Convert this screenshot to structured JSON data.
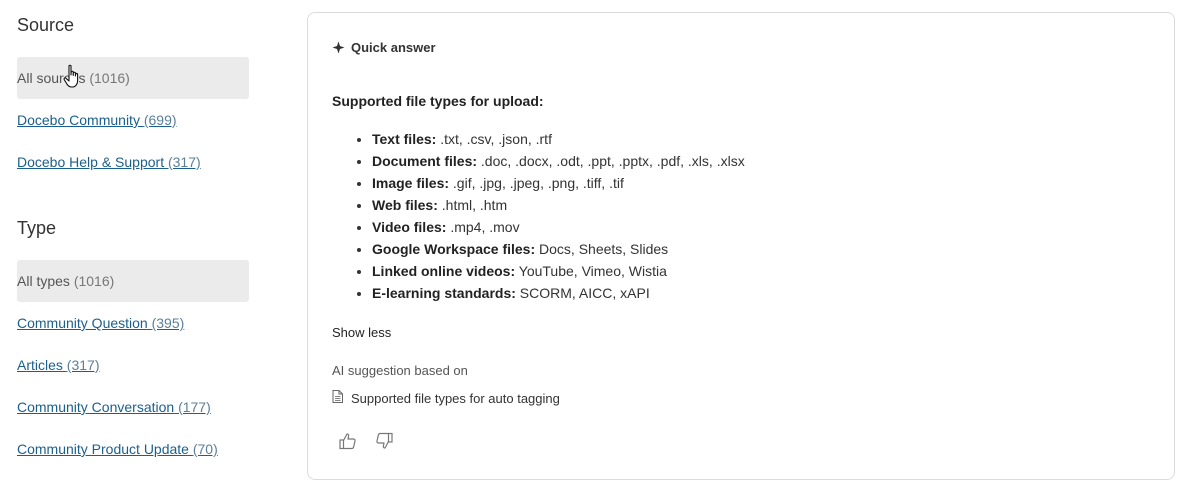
{
  "sidebar": {
    "source": {
      "title": "Source",
      "items": [
        {
          "label": "All sources",
          "count": "(1016)",
          "selected": true
        },
        {
          "label": "Docebo Community",
          "count": "(699)",
          "selected": false
        },
        {
          "label": "Docebo Help & Support",
          "count": "(317)",
          "selected": false
        }
      ]
    },
    "type": {
      "title": "Type",
      "items": [
        {
          "label": "All types",
          "count": "(1016)",
          "selected": true
        },
        {
          "label": "Community Question",
          "count": "(395)",
          "selected": false
        },
        {
          "label": "Articles",
          "count": "(317)",
          "selected": false
        },
        {
          "label": "Community Conversation",
          "count": "(177)",
          "selected": false
        },
        {
          "label": "Community Product Update",
          "count": "(70)",
          "selected": false
        }
      ]
    }
  },
  "answer": {
    "header": "Quick answer",
    "title": "Supported file types for upload:",
    "items": [
      {
        "label": "Text files:",
        "value": " .txt, .csv, .json, .rtf"
      },
      {
        "label": "Document files:",
        "value": " .doc, .docx, .odt, .ppt, .pptx, .pdf, .xls, .xlsx"
      },
      {
        "label": "Image files:",
        "value": " .gif, .jpg, .jpeg, .png, .tiff, .tif"
      },
      {
        "label": "Web files:",
        "value": " .html, .htm"
      },
      {
        "label": "Video files:",
        "value": " .mp4, .mov"
      },
      {
        "label": "Google Workspace files:",
        "value": " Docs, Sheets, Slides"
      },
      {
        "label": "Linked online videos:",
        "value": " YouTube, Vimeo, Wistia"
      },
      {
        "label": "E-learning standards:",
        "value": " SCORM, AICC, xAPI"
      }
    ],
    "show_less": "Show less",
    "ai_basis": "AI suggestion based on",
    "source_title": "Supported file types for auto tagging"
  },
  "icons": {
    "sparkle": "sparkle-icon",
    "document": "document-icon",
    "thumbs_up": "thumbs-up-icon",
    "thumbs_down": "thumbs-down-icon",
    "cursor": "hand-cursor-icon"
  },
  "colors": {
    "link": "#1b5f8c",
    "selected_bg": "#ebebeb",
    "card_border": "#dcdcdc"
  }
}
